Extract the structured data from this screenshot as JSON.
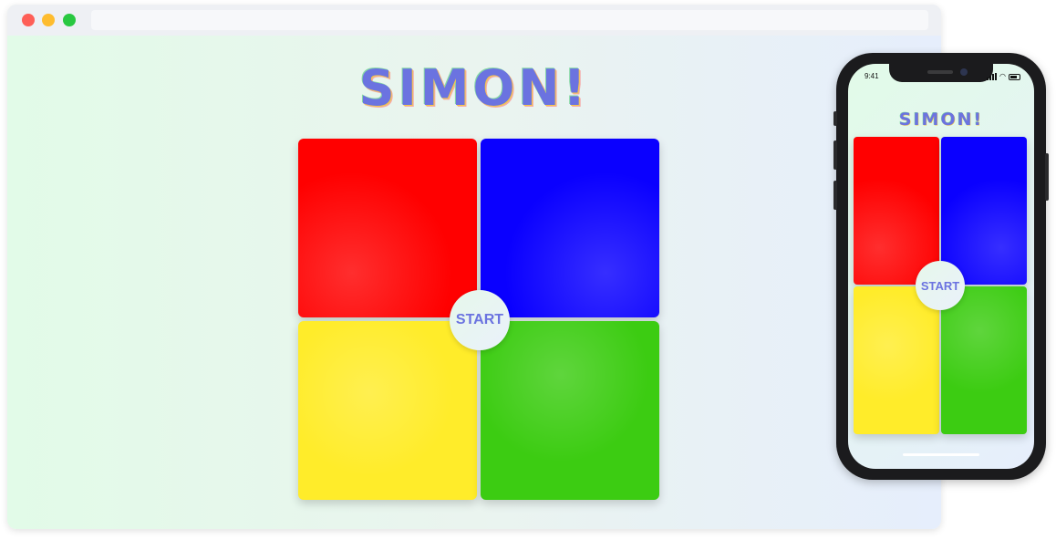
{
  "app": {
    "title": "SIMON!",
    "start_label": "START"
  },
  "colors": {
    "red": "#ff0000",
    "blue": "#0a00ff",
    "yellow": "#ffec2a",
    "green": "#3ccc12",
    "title": "#6b73e0",
    "window_close": "#fe5f57",
    "window_minimize": "#febc2e",
    "window_maximize": "#28c840"
  },
  "phone": {
    "status_time": "9:41",
    "icons": [
      "signal-icon",
      "wifi-icon",
      "battery-icon"
    ]
  }
}
